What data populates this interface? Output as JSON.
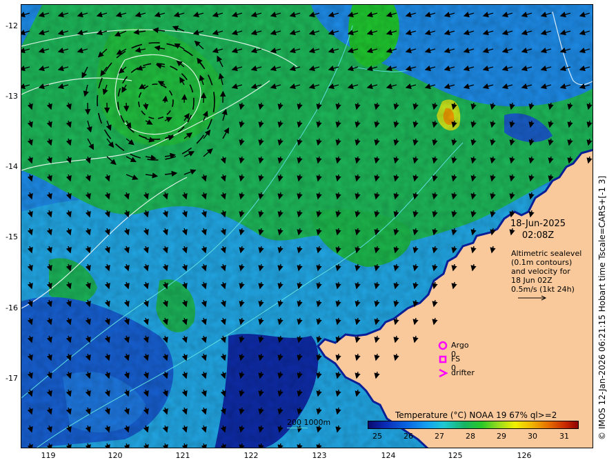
{
  "map": {
    "y_axis_labels": [
      "-12",
      "-13",
      "-14",
      "-15",
      "-16",
      "-17"
    ],
    "x_axis_labels": [
      "119",
      "120",
      "121",
      "122",
      "123",
      "124",
      "125",
      "126"
    ],
    "date": "18-Jun-2025",
    "time": "02:08Z",
    "description_lines": [
      "Altimetric sealevel",
      "(0.1m contours)",
      "and velocity for",
      "18 Jun 02Z",
      "0.5m/s (1kt 24h)"
    ],
    "side_credit": "© IMOS 12-Jan-2026 06:21:15 Hobart time Tscale=CARS+[-1 3]",
    "legend": {
      "argo": "Argo 0",
      "fs": "FS 0",
      "drifter": "drifter"
    },
    "colorbar": {
      "title": "Temperature (°C) NOAA 19 67% ql>=2",
      "ticks": [
        "25",
        "26",
        "27",
        "28",
        "29",
        "30",
        "31"
      ]
    },
    "depth_scale_label": "200  1000m",
    "colors": {
      "land": "#f9c99b",
      "ocean_deep": "#0a1e96",
      "ocean_mid": "#1478e6",
      "ocean_warm": "#1ec864",
      "marker": "#ff00ff",
      "contour": "#ffffff",
      "isobath": "#5fe0e0"
    }
  }
}
